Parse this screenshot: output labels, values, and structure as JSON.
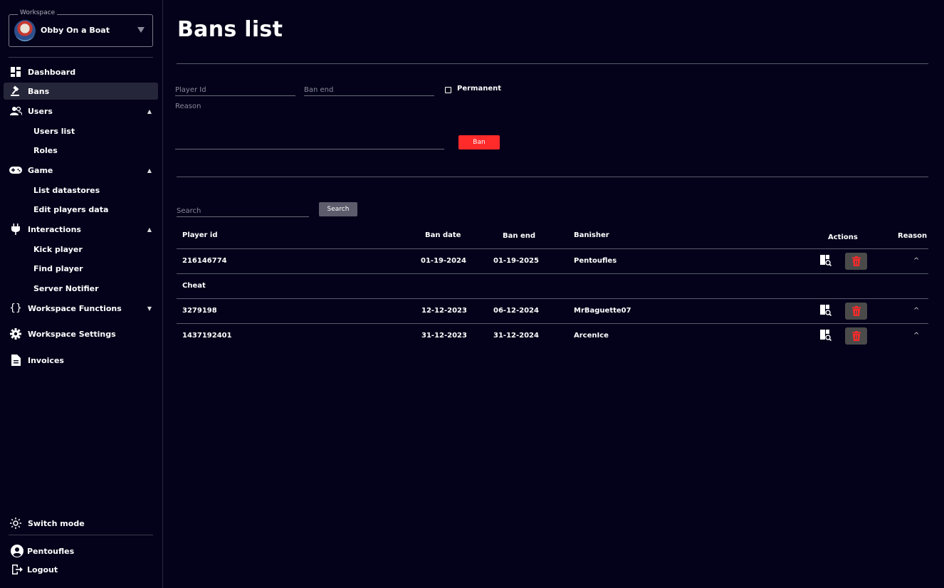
{
  "sidebar": {
    "workspace_label": "Workspace",
    "workspace_name": "Obby On a Boat",
    "items": [
      {
        "label": "Dashboard",
        "icon": "dashboard-icon"
      },
      {
        "label": "Bans",
        "icon": "gavel-icon",
        "active": true
      },
      {
        "label": "Users",
        "icon": "users-icon",
        "expanded": true,
        "children": [
          "Users list",
          "Roles"
        ]
      },
      {
        "label": "Game",
        "icon": "gamepad-icon",
        "expanded": true,
        "children": [
          "List datastores",
          "Edit players data"
        ]
      },
      {
        "label": "Interactions",
        "icon": "plug-icon",
        "expanded": true,
        "children": [
          "Kick player",
          "Find player",
          "Server Notifier"
        ]
      },
      {
        "label": "Workspace Functions",
        "icon": "braces-icon",
        "expanded": false
      },
      {
        "label": "Workspace Settings",
        "icon": "gear-icon"
      },
      {
        "label": "Invoices",
        "icon": "document-icon"
      }
    ],
    "switch_mode": "Switch mode",
    "user_name": "Pentoufles",
    "logout": "Logout"
  },
  "main": {
    "title": "Bans list",
    "form": {
      "player_id_placeholder": "Player Id",
      "ban_end_placeholder": "Ban end",
      "permanent_label": "Permanent",
      "reason_placeholder": "Reason",
      "ban_button": "Ban"
    },
    "search": {
      "placeholder": "Search",
      "button": "Search"
    },
    "table": {
      "headers": {
        "player_id": "Player id",
        "ban_date": "Ban date",
        "ban_end": "Ban end",
        "banisher": "Banisher",
        "actions": "Actions",
        "reason": "Reason"
      },
      "rows": [
        {
          "player_id": "216146774",
          "ban_date": "01-19-2024",
          "ban_end": "01-19-2025",
          "banisher": "Pentoufles",
          "reason": "Cheat",
          "reason_expanded": true
        },
        {
          "player_id": "3279198",
          "ban_date": "12-12-2023",
          "ban_end": "06-12-2024",
          "banisher": "MrBaguette07",
          "reason_expanded": false
        },
        {
          "player_id": "1437192401",
          "ban_date": "31-12-2023",
          "ban_end": "31-12-2024",
          "banisher": "ArcenIce",
          "reason_expanded": false
        }
      ]
    }
  },
  "colors": {
    "background": "#03021a",
    "active_nav": "#26263a",
    "ban_button": "#ff2a2a",
    "delete_icon": "#ff2a2a",
    "delete_bg": "#4a4a4a"
  }
}
